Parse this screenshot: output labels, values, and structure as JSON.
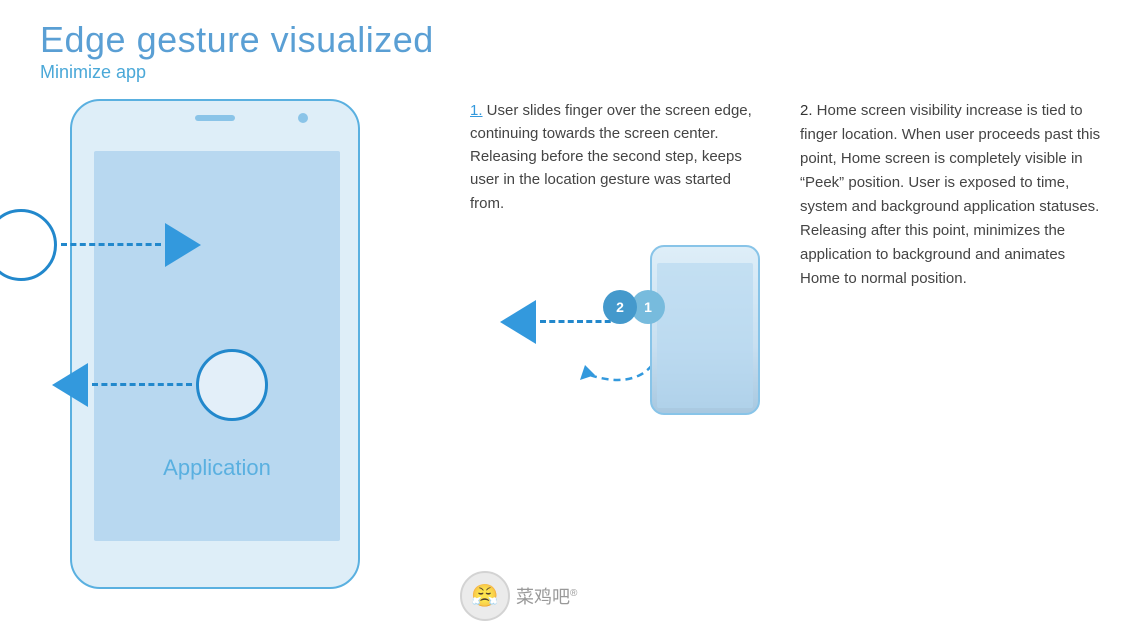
{
  "header": {
    "title": "Edge gesture visualized",
    "subtitle": "Minimize app"
  },
  "step1": {
    "number": "1.",
    "text": " User slides finger over the screen edge, continuing towards the screen center. Releasing before the second step, keeps user in the location gesture was started from."
  },
  "step2": {
    "number": "2.",
    "text": " Home screen visibility increase is tied to finger location. When user proceeds past this point, Home screen is completely visible in “Peek” position. User is exposed to time, system and background application statuses. Releasing after this point, minimizes the application to background and animates Home to normal position."
  },
  "phone": {
    "app_label": "Application"
  },
  "circles": {
    "c1": "1",
    "c2": "2"
  },
  "watermark": {
    "logo_emoji": "😤",
    "text": "菜鸡吧",
    "reg": "®"
  }
}
